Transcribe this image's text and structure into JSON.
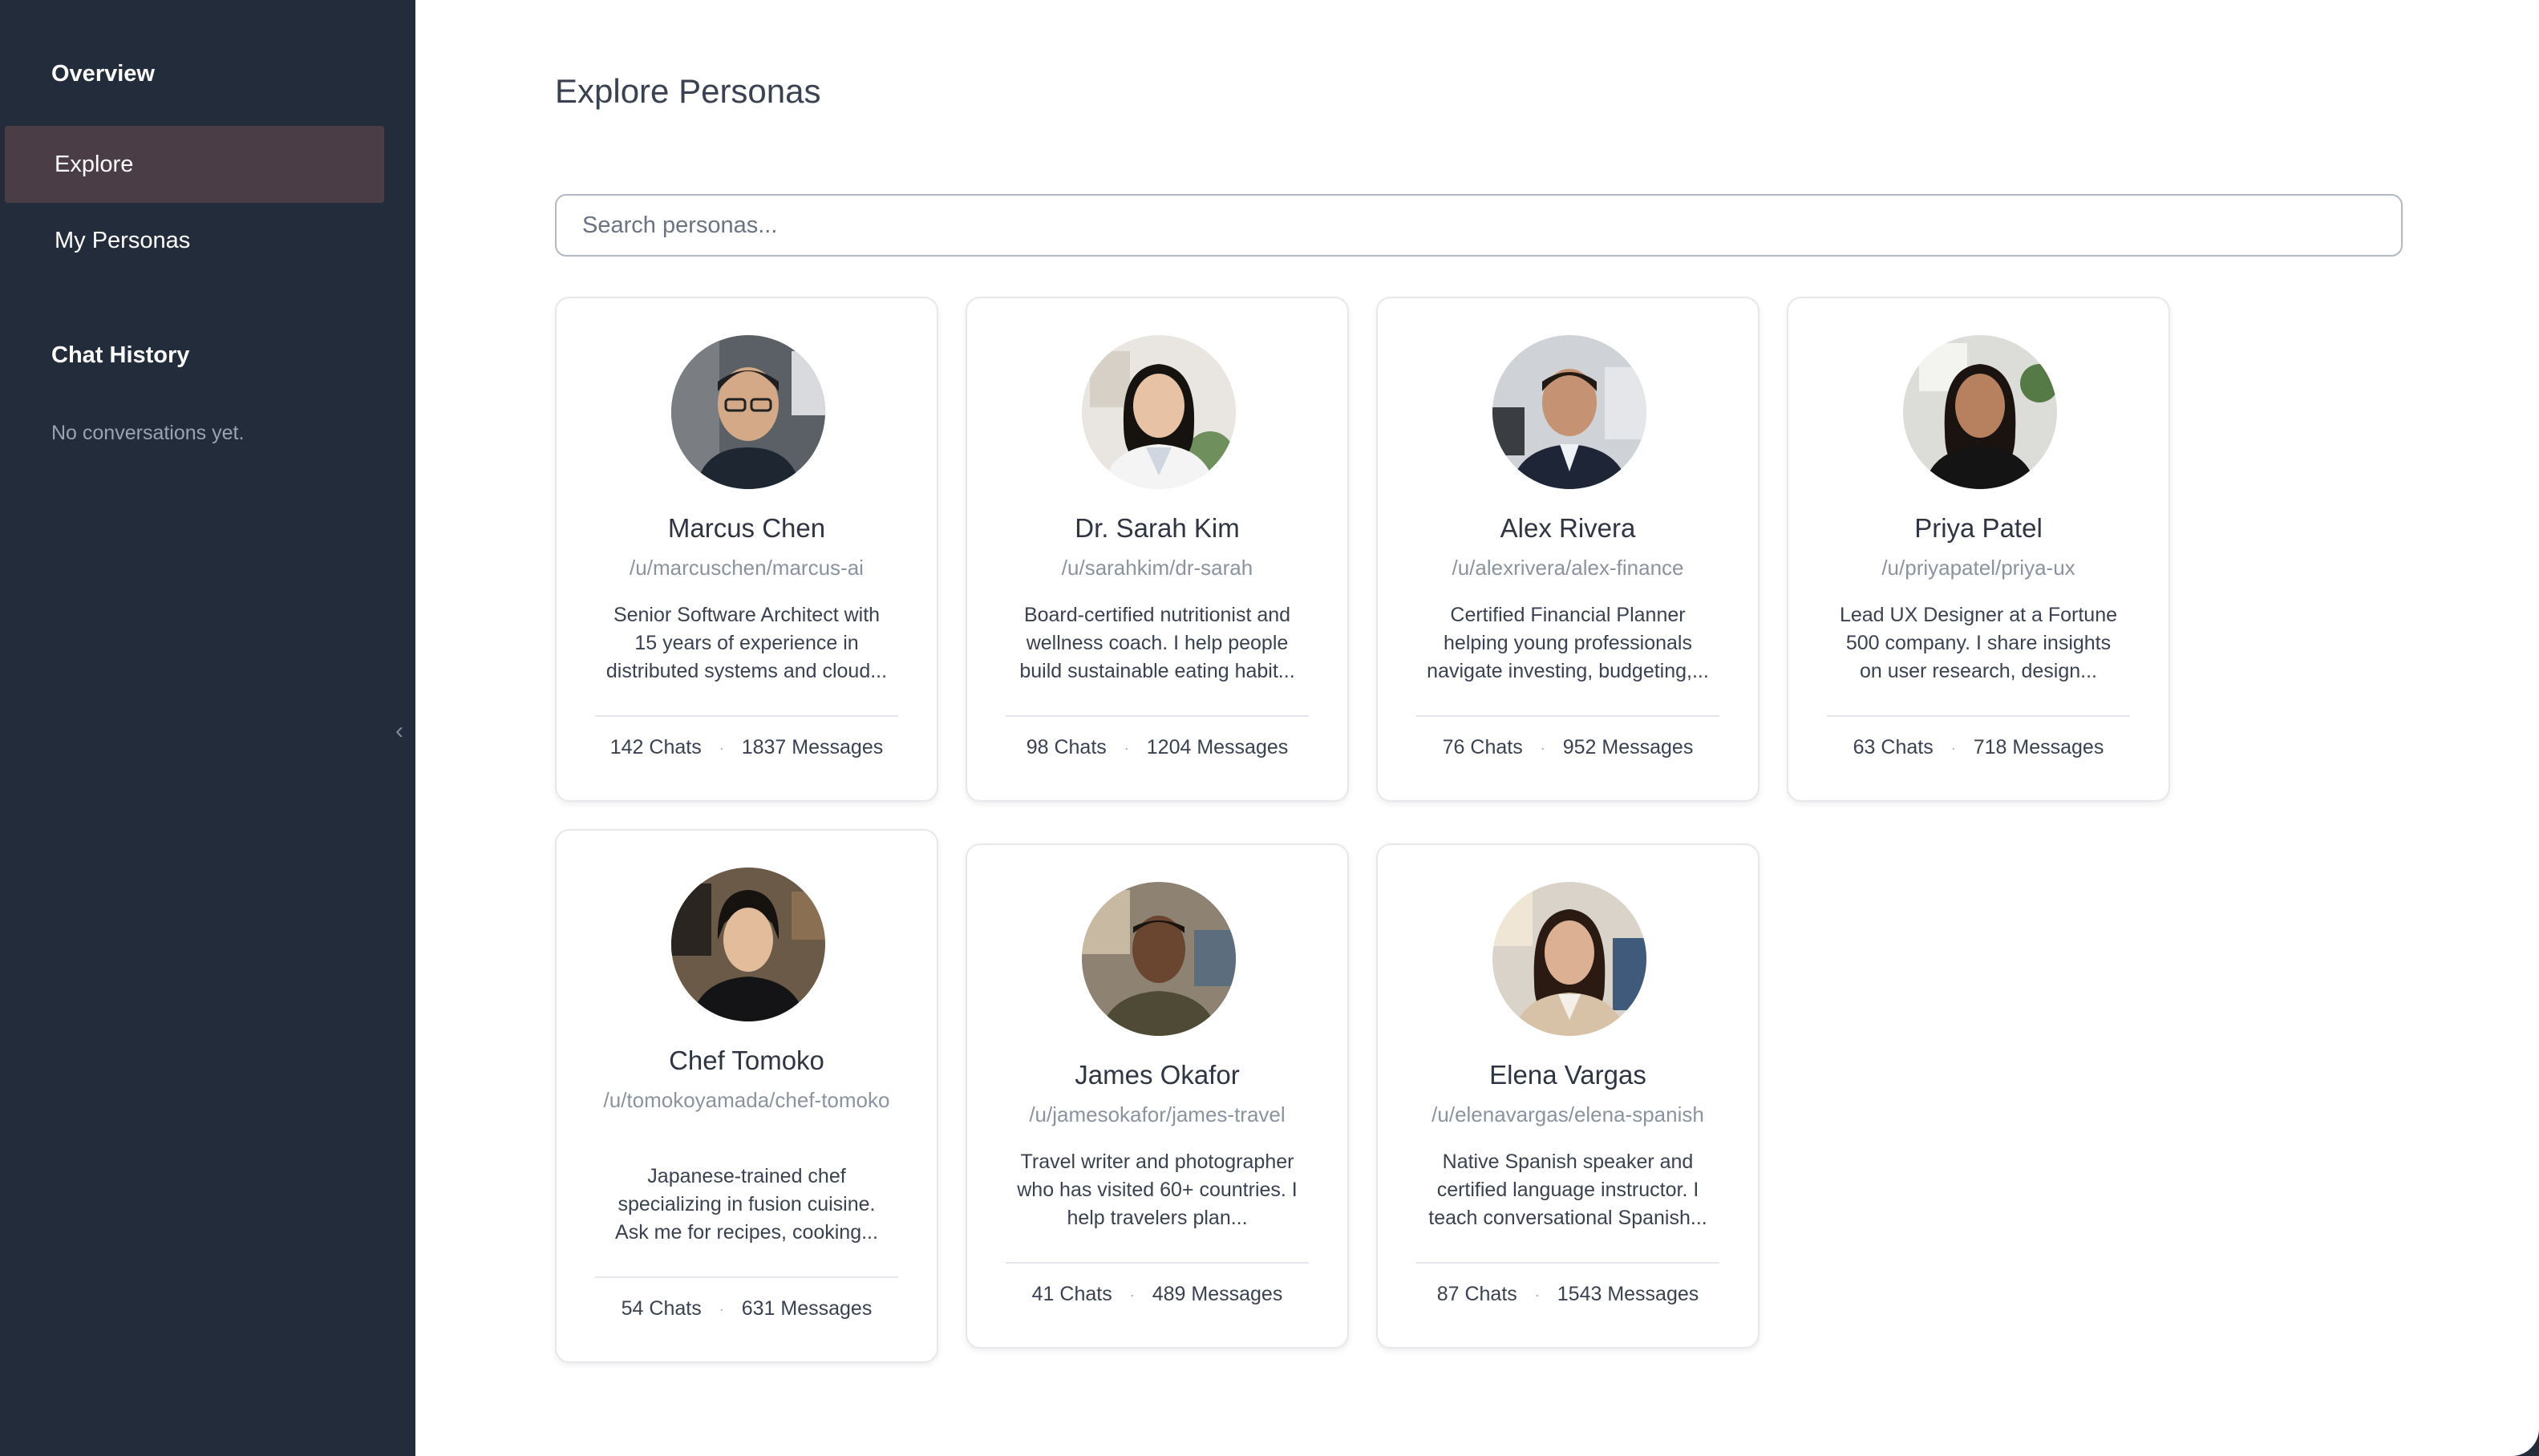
{
  "sidebar": {
    "overview_heading": "Overview",
    "nav": [
      {
        "label": "Explore",
        "active": true
      },
      {
        "label": "My Personas",
        "active": false
      }
    ],
    "chat_history_heading": "Chat History",
    "empty_note": "No conversations yet.",
    "collapse_icon": "chevron-left-icon",
    "collapse_glyph": "‹"
  },
  "main": {
    "title": "Explore Personas",
    "search_placeholder": "Search personas...",
    "search_value": ""
  },
  "personas": [
    {
      "name": "Marcus Chen",
      "handle": "/u/marcuschen/marcus-ai",
      "desc": [
        "Senior Software Architect with",
        "15 years of experience in",
        "distributed systems and cloud..."
      ],
      "chats": "142 Chats",
      "messages": "1837 Messages"
    },
    {
      "name": "Dr. Sarah Kim",
      "handle": "/u/sarahkim/dr-sarah",
      "desc": [
        "Board-certified nutritionist and",
        "wellness coach. I help people",
        "build sustainable eating habit..."
      ],
      "chats": "98 Chats",
      "messages": "1204 Messages"
    },
    {
      "name": "Alex Rivera",
      "handle": "/u/alexrivera/alex-finance",
      "desc": [
        "Certified Financial Planner",
        "helping young professionals",
        "navigate investing, budgeting,..."
      ],
      "chats": "76 Chats",
      "messages": "952 Messages"
    },
    {
      "name": "Priya Patel",
      "handle": "/u/priyapatel/priya-ux",
      "desc": [
        "Lead UX Designer at a Fortune",
        "500 company. I share insights",
        "on user research, design..."
      ],
      "chats": "63 Chats",
      "messages": "718 Messages"
    },
    {
      "name": "Chef Tomoko",
      "handle": "/u/tomokoyamada/chef-tomoko",
      "desc": [
        "Japanese-trained chef",
        "specializing in fusion cuisine.",
        "Ask me for recipes, cooking..."
      ],
      "chats": "54 Chats",
      "messages": "631 Messages"
    },
    {
      "name": "James Okafor",
      "handle": "/u/jamesokafor/james-travel",
      "desc": [
        "Travel writer and photographer",
        "who has visited 60+ countries. I",
        "help travelers plan..."
      ],
      "chats": "41 Chats",
      "messages": "489 Messages"
    },
    {
      "name": "Elena Vargas",
      "handle": "/u/elenavargas/elena-spanish",
      "desc": [
        "Native Spanish speaker and",
        "certified language instructor. I",
        "teach conversational Spanish..."
      ],
      "chats": "87 Chats",
      "messages": "1543 Messages"
    }
  ],
  "stat_separator": "·",
  "colors": {
    "sidebar_bg": "#232c3b",
    "active_item_bg": "#4b3d45",
    "main_bg": "#ffffff",
    "text_dark": "#3a4150",
    "text_muted": "#8b92a0"
  }
}
